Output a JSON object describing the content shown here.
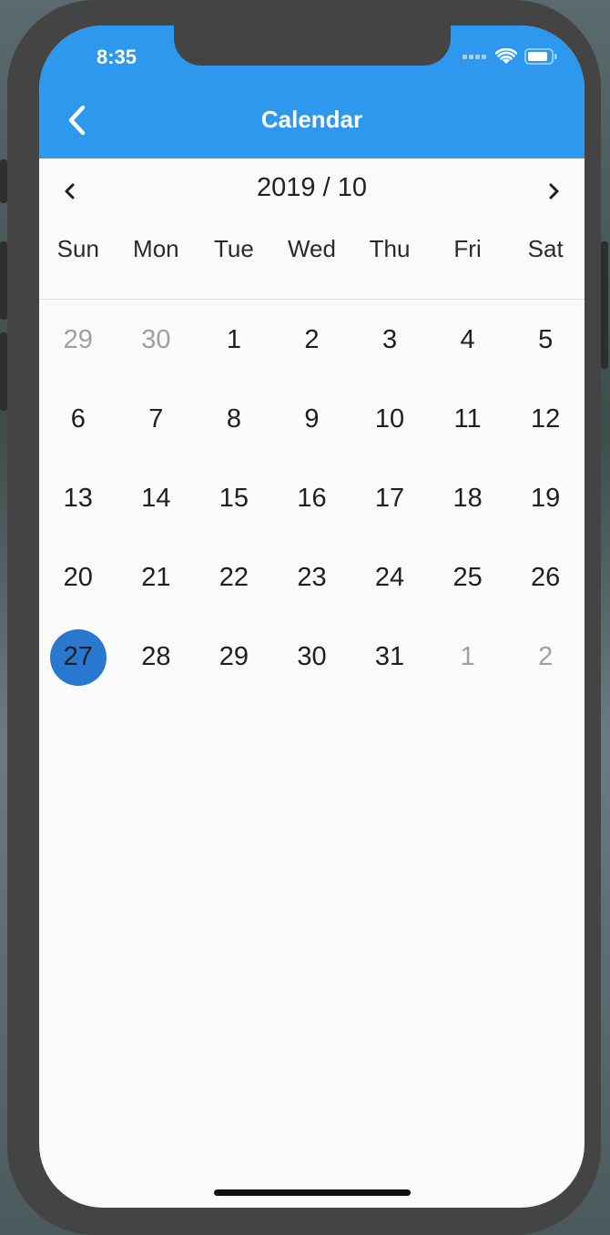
{
  "status_bar": {
    "time": "8:35",
    "icons": [
      "cellular-signal-icon",
      "wifi-icon",
      "battery-icon"
    ]
  },
  "app_bar": {
    "title": "Calendar",
    "back_icon": "chevron-left-icon",
    "background_color": "#2d98ee"
  },
  "calendar": {
    "month_label": "2019 / 10",
    "prev_icon": "chevron-left-icon",
    "next_icon": "chevron-right-icon",
    "weekdays": [
      "Sun",
      "Mon",
      "Tue",
      "Wed",
      "Thu",
      "Fri",
      "Sat"
    ],
    "weeks": [
      [
        {
          "day": "29",
          "outside": true
        },
        {
          "day": "30",
          "outside": true
        },
        {
          "day": "1"
        },
        {
          "day": "2"
        },
        {
          "day": "3"
        },
        {
          "day": "4"
        },
        {
          "day": "5"
        }
      ],
      [
        {
          "day": "6"
        },
        {
          "day": "7"
        },
        {
          "day": "8"
        },
        {
          "day": "9"
        },
        {
          "day": "10"
        },
        {
          "day": "11"
        },
        {
          "day": "12"
        }
      ],
      [
        {
          "day": "13"
        },
        {
          "day": "14"
        },
        {
          "day": "15"
        },
        {
          "day": "16"
        },
        {
          "day": "17"
        },
        {
          "day": "18"
        },
        {
          "day": "19"
        }
      ],
      [
        {
          "day": "20"
        },
        {
          "day": "21"
        },
        {
          "day": "22"
        },
        {
          "day": "23"
        },
        {
          "day": "24"
        },
        {
          "day": "25"
        },
        {
          "day": "26"
        }
      ],
      [
        {
          "day": "27",
          "selected": true
        },
        {
          "day": "28"
        },
        {
          "day": "29"
        },
        {
          "day": "30"
        },
        {
          "day": "31"
        },
        {
          "day": "1",
          "outside": true
        },
        {
          "day": "2",
          "outside": true
        }
      ]
    ],
    "selected_color": "#2878d0",
    "outside_day_color": "#a0a0a0"
  }
}
